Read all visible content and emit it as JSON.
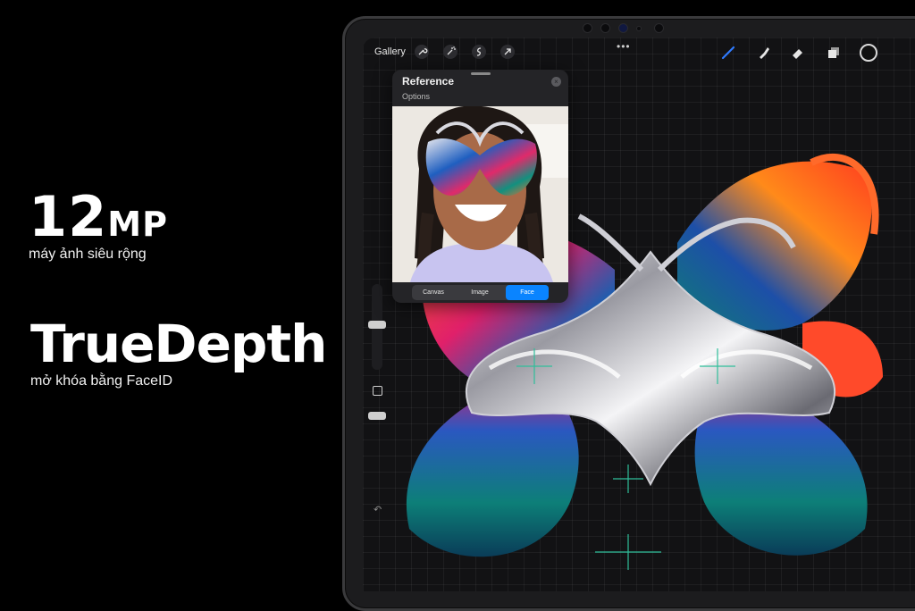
{
  "promo": {
    "camera_value": "12",
    "camera_unit": "MP",
    "camera_desc": "máy ảnh siêu rộng",
    "depth_title": "TrueDepth",
    "depth_desc": "mở khóa bằng FaceID"
  },
  "toolbar": {
    "gallery_label": "Gallery",
    "icons": [
      "wrench-icon",
      "magic-wand-icon",
      "selection-icon",
      "transform-arrow-icon"
    ],
    "tools": [
      "brush-icon",
      "smudge-icon",
      "eraser-icon",
      "layers-icon",
      "color-well"
    ],
    "brush_active_color": "#2f7bff"
  },
  "reference_panel": {
    "title": "Reference",
    "options_label": "Options",
    "tabs": [
      {
        "label": "Canvas",
        "active": false
      },
      {
        "label": "Image",
        "active": false
      },
      {
        "label": "Face",
        "active": true
      }
    ],
    "active_tab_color": "#0a84ff"
  },
  "colors": {
    "background": "#000000",
    "canvas_guide": "#2fbf9a"
  }
}
